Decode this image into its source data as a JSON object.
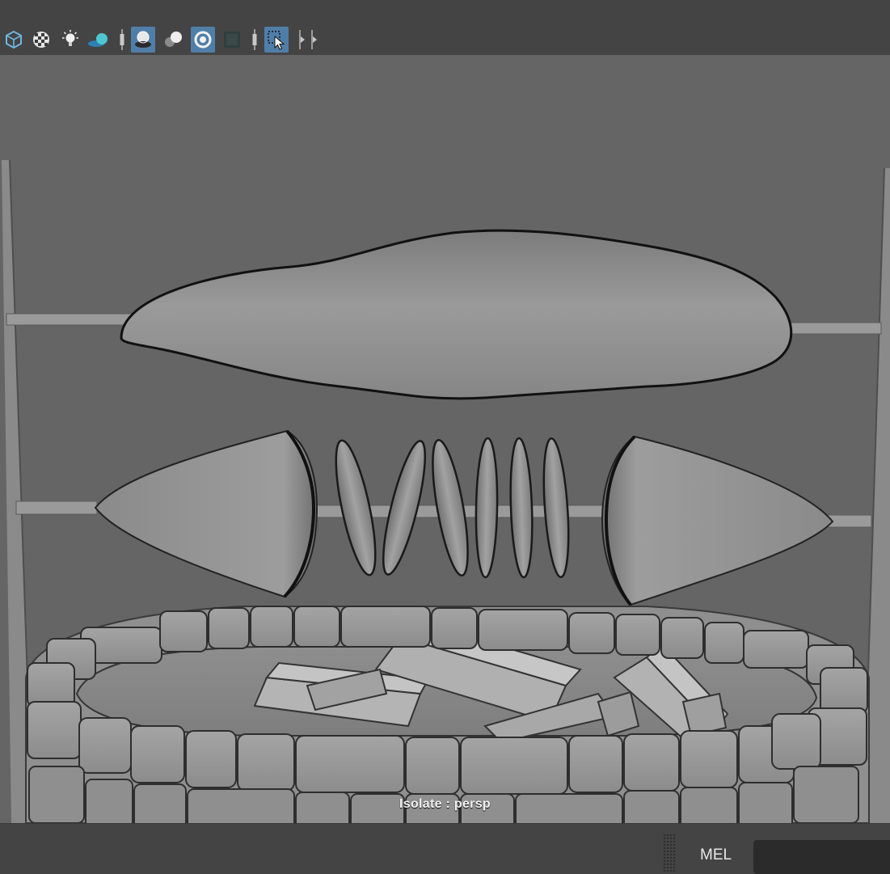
{
  "toolbar": {
    "icons": [
      {
        "name": "wireframe-cube-icon"
      },
      {
        "name": "checker-texture-icon"
      },
      {
        "name": "lighting-bulb-icon"
      },
      {
        "name": "shadows-icon"
      },
      {
        "name": "ambient-occlusion-icon",
        "active": true
      },
      {
        "name": "motion-blur-icon"
      },
      {
        "name": "anti-aliasing-icon",
        "active": true
      },
      {
        "name": "depth-of-field-icon"
      },
      {
        "name": "isolate-select-icon",
        "active": true
      }
    ]
  },
  "viewport": {
    "isolate_label": "Isolate : persp"
  },
  "statusbar": {
    "command_language": "MEL",
    "command_value": "",
    "command_placeholder": ""
  },
  "colors": {
    "panel_bg": "#444444",
    "viewport_bg": "#656565",
    "active_button": "#4f7fa8"
  }
}
